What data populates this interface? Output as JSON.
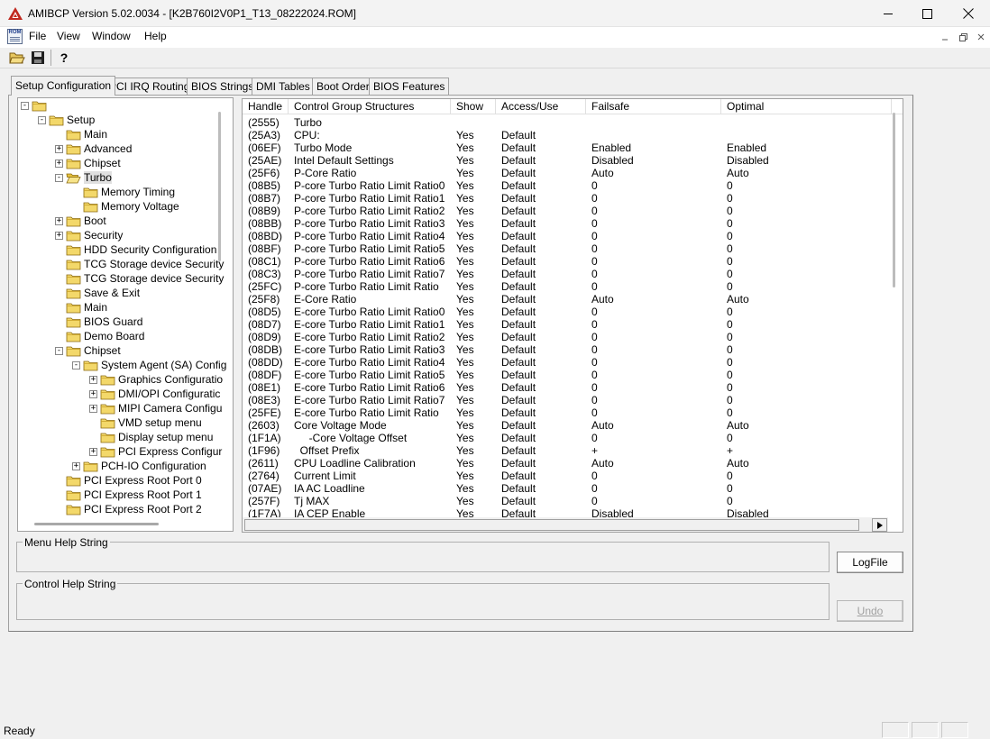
{
  "window": {
    "title": "AMIBCP Version 5.02.0034 - [K2B760I2V0P1_T13_08222024.ROM]",
    "minimize_glyph": "—",
    "maximize_glyph": "☐",
    "close_glyph": "✕"
  },
  "menu": {
    "icon_text": "ROM",
    "items": [
      "File",
      "View",
      "Window",
      "Help"
    ]
  },
  "toolbar": {
    "icons": [
      "open-folder-icon",
      "save-disk-icon",
      "help-question-icon"
    ],
    "help_glyph": "?"
  },
  "tabs": [
    {
      "label": "Setup Configuration",
      "active": true
    },
    {
      "label": "PCI IRQ Routing",
      "active": false
    },
    {
      "label": "BIOS Strings",
      "active": false
    },
    {
      "label": "DMI Tables",
      "active": false
    },
    {
      "label": "Boot Order",
      "active": false
    },
    {
      "label": "BIOS Features",
      "active": false
    }
  ],
  "tree": {
    "nodes": [
      {
        "label": "",
        "level": 0,
        "expander": "-"
      },
      {
        "label": "Setup",
        "level": 1,
        "expander": "-"
      },
      {
        "label": "Main",
        "level": 2,
        "expander": ""
      },
      {
        "label": "Advanced",
        "level": 2,
        "expander": "+"
      },
      {
        "label": "Chipset",
        "level": 2,
        "expander": "+"
      },
      {
        "label": "Turbo",
        "level": 2,
        "expander": "-",
        "selected": true,
        "open": true
      },
      {
        "label": "Memory Timing",
        "level": 3,
        "expander": ""
      },
      {
        "label": "Memory Voltage",
        "level": 3,
        "expander": ""
      },
      {
        "label": "Boot",
        "level": 2,
        "expander": "+"
      },
      {
        "label": "Security",
        "level": 2,
        "expander": "+"
      },
      {
        "label": "HDD Security Configuration",
        "level": 2,
        "expander": ""
      },
      {
        "label": "TCG Storage device Security",
        "level": 2,
        "expander": ""
      },
      {
        "label": "TCG Storage device Security",
        "level": 2,
        "expander": ""
      },
      {
        "label": "Save & Exit",
        "level": 2,
        "expander": ""
      },
      {
        "label": "Main",
        "level": 2,
        "expander": ""
      },
      {
        "label": "BIOS Guard",
        "level": 2,
        "expander": ""
      },
      {
        "label": "Demo Board",
        "level": 2,
        "expander": ""
      },
      {
        "label": "Chipset",
        "level": 2,
        "expander": "-"
      },
      {
        "label": "System Agent (SA) Config",
        "level": 3,
        "expander": "-"
      },
      {
        "label": "Graphics Configuratio",
        "level": 4,
        "expander": "+"
      },
      {
        "label": "DMI/OPI Configuratic",
        "level": 4,
        "expander": "+"
      },
      {
        "label": "MIPI Camera Configu",
        "level": 4,
        "expander": "+"
      },
      {
        "label": "VMD setup menu",
        "level": 4,
        "expander": ""
      },
      {
        "label": "Display setup menu",
        "level": 4,
        "expander": ""
      },
      {
        "label": "PCI Express Configur",
        "level": 4,
        "expander": "+"
      },
      {
        "label": "PCH-IO Configuration",
        "level": 3,
        "expander": "+"
      },
      {
        "label": "PCI Express Root Port 0",
        "level": 2,
        "expander": ""
      },
      {
        "label": "PCI Express Root Port 1",
        "level": 2,
        "expander": ""
      },
      {
        "label": "PCI Express Root Port 2",
        "level": 2,
        "expander": ""
      }
    ]
  },
  "grid": {
    "columns": [
      "Handle",
      "Control Group Structures",
      "Show",
      "Access/Use",
      "Failsafe",
      "Optimal"
    ],
    "rows": [
      [
        "(2555)",
        "Turbo",
        "",
        "",
        "",
        ""
      ],
      [
        "(25A3)",
        "CPU:",
        "Yes",
        "Default",
        "",
        ""
      ],
      [
        "(06EF)",
        "Turbo Mode",
        "Yes",
        "Default",
        "Enabled",
        "Enabled"
      ],
      [
        "(25AE)",
        "Intel Default Settings",
        "Yes",
        "Default",
        "Disabled",
        "Disabled"
      ],
      [
        "(25F6)",
        "P-Core Ratio",
        "Yes",
        "Default",
        "Auto",
        "Auto"
      ],
      [
        "(08B5)",
        "P-core Turbo Ratio Limit Ratio0",
        "Yes",
        "Default",
        "0",
        "0"
      ],
      [
        "(08B7)",
        "P-core Turbo Ratio Limit Ratio1",
        "Yes",
        "Default",
        "0",
        "0"
      ],
      [
        "(08B9)",
        "P-core Turbo Ratio Limit Ratio2",
        "Yes",
        "Default",
        "0",
        "0"
      ],
      [
        "(08BB)",
        "P-core Turbo Ratio Limit Ratio3",
        "Yes",
        "Default",
        "0",
        "0"
      ],
      [
        "(08BD)",
        "P-core Turbo Ratio Limit Ratio4",
        "Yes",
        "Default",
        "0",
        "0"
      ],
      [
        "(08BF)",
        "P-core Turbo Ratio Limit Ratio5",
        "Yes",
        "Default",
        "0",
        "0"
      ],
      [
        "(08C1)",
        "P-core Turbo Ratio Limit Ratio6",
        "Yes",
        "Default",
        "0",
        "0"
      ],
      [
        "(08C3)",
        "P-core Turbo Ratio Limit Ratio7",
        "Yes",
        "Default",
        "0",
        "0"
      ],
      [
        "(25FC)",
        "P-core Turbo Ratio Limit Ratio",
        "Yes",
        "Default",
        "0",
        "0"
      ],
      [
        "(25F8)",
        "E-Core Ratio",
        "Yes",
        "Default",
        "Auto",
        "Auto"
      ],
      [
        "(08D5)",
        "E-core Turbo Ratio Limit Ratio0",
        "Yes",
        "Default",
        "0",
        "0"
      ],
      [
        "(08D7)",
        "E-core Turbo Ratio Limit Ratio1",
        "Yes",
        "Default",
        "0",
        "0"
      ],
      [
        "(08D9)",
        "E-core Turbo Ratio Limit Ratio2",
        "Yes",
        "Default",
        "0",
        "0"
      ],
      [
        "(08DB)",
        "E-core Turbo Ratio Limit Ratio3",
        "Yes",
        "Default",
        "0",
        "0"
      ],
      [
        "(08DD)",
        "E-core Turbo Ratio Limit Ratio4",
        "Yes",
        "Default",
        "0",
        "0"
      ],
      [
        "(08DF)",
        "E-core Turbo Ratio Limit Ratio5",
        "Yes",
        "Default",
        "0",
        "0"
      ],
      [
        "(08E1)",
        "E-core Turbo Ratio Limit Ratio6",
        "Yes",
        "Default",
        "0",
        "0"
      ],
      [
        "(08E3)",
        "E-core Turbo Ratio Limit Ratio7",
        "Yes",
        "Default",
        "0",
        "0"
      ],
      [
        "(25FE)",
        "E-core Turbo Ratio Limit Ratio",
        "Yes",
        "Default",
        "0",
        "0"
      ],
      [
        "(2603)",
        "Core Voltage Mode",
        "Yes",
        "Default",
        "Auto",
        "Auto"
      ],
      [
        "(1F1A)",
        "     -Core Voltage Offset",
        "Yes",
        "Default",
        "0",
        "0"
      ],
      [
        "(1F96)",
        "  Offset Prefix",
        "Yes",
        "Default",
        "+",
        "+"
      ],
      [
        "(2611)",
        "CPU Loadline Calibration",
        "Yes",
        "Default",
        "Auto",
        "Auto"
      ],
      [
        "(2764)",
        "Current Limit",
        "Yes",
        "Default",
        "0",
        "0"
      ],
      [
        "(07AE)",
        "IA AC Loadline",
        "Yes",
        "Default",
        "0",
        "0"
      ],
      [
        "(257F)",
        "Tj MAX",
        "Yes",
        "Default",
        "0",
        "0"
      ],
      [
        "(1F7A)",
        "IA CEP Enable",
        "Yes",
        "Default",
        "Disabled",
        "Disabled"
      ]
    ]
  },
  "help": {
    "menu_label": "Menu Help String",
    "control_label": "Control Help String"
  },
  "buttons": {
    "logfile": "LogFile",
    "undo": "Undo"
  },
  "status": {
    "text": "Ready"
  }
}
